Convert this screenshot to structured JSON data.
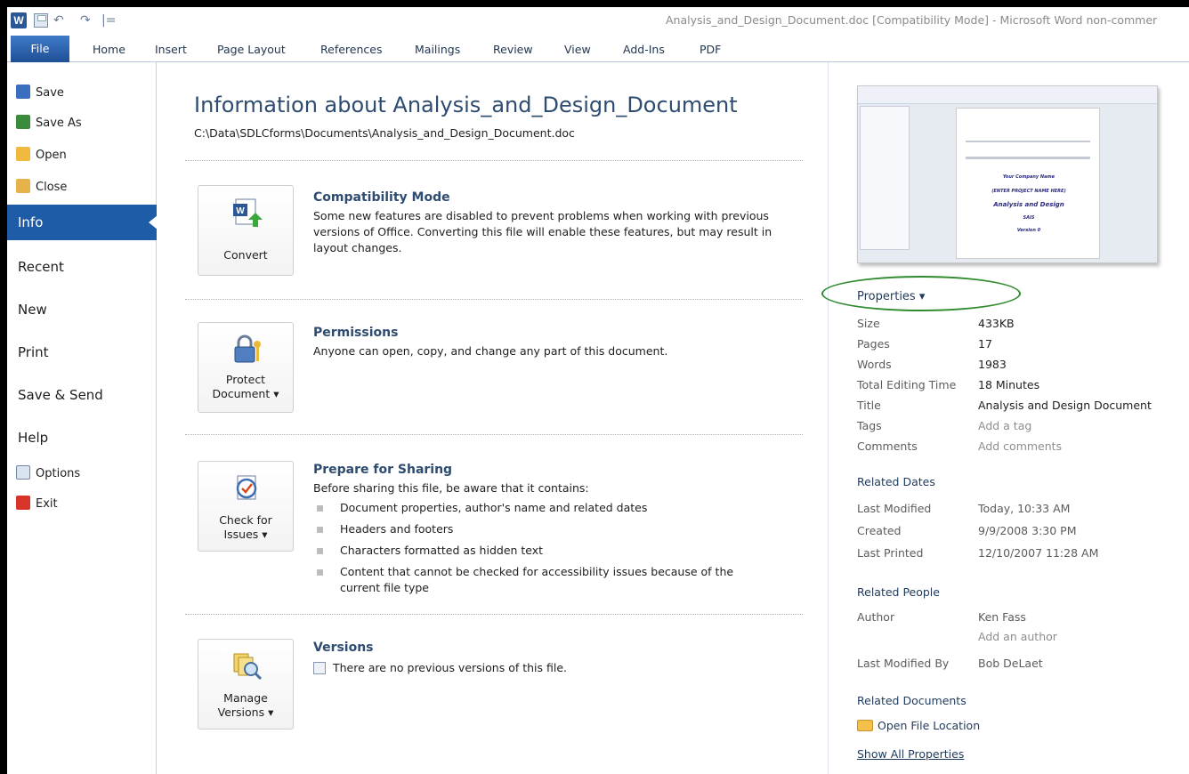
{
  "window": {
    "app_icon_label": "W",
    "title": "Analysis_and_Design_Document.doc [Compatibility Mode] - Microsoft Word non-commer",
    "qat_undo": "↶",
    "qat_redo": "↷",
    "qat_custom": "|="
  },
  "tabs": [
    {
      "label": "File"
    },
    {
      "label": "Home"
    },
    {
      "label": "Insert"
    },
    {
      "label": "Page Layout"
    },
    {
      "label": "References"
    },
    {
      "label": "Mailings"
    },
    {
      "label": "Review"
    },
    {
      "label": "View"
    },
    {
      "label": "Add-Ins"
    },
    {
      "label": "PDF"
    }
  ],
  "nav": {
    "commands": [
      {
        "label": "Save",
        "icon": "save-icon"
      },
      {
        "label": "Save As",
        "icon": "save-as-icon"
      },
      {
        "label": "Open",
        "icon": "open-folder-icon"
      },
      {
        "label": "Close",
        "icon": "close-folder-icon"
      }
    ],
    "items": [
      {
        "label": "Info"
      },
      {
        "label": "Recent"
      },
      {
        "label": "New"
      },
      {
        "label": "Print"
      },
      {
        "label": "Save & Send"
      },
      {
        "label": "Help"
      }
    ],
    "options_label": "Options",
    "exit_label": "Exit"
  },
  "main": {
    "title": "Information about Analysis_and_Design_Document",
    "path": "C:\\Data\\SDLCforms\\Documents\\Analysis_and_Design_Document.doc",
    "compat": {
      "button": "Convert",
      "title": "Compatibility Mode",
      "text": "Some new features are disabled to prevent problems when working with previous versions of Office. Converting this file will enable these features, but may result in layout changes."
    },
    "permissions": {
      "button_line1": "Protect",
      "button_line2": "Document ▾",
      "title": "Permissions",
      "text": "Anyone can open, copy, and change any part of this document."
    },
    "sharing": {
      "button_line1": "Check for",
      "button_line2": "Issues ▾",
      "title": "Prepare for Sharing",
      "intro": "Before sharing this file, be aware that it contains:",
      "bullets": [
        "Document properties, author's name and related dates",
        "Headers and footers",
        "Characters formatted as hidden text",
        "Content that cannot be checked for accessibility issues because of the current file type"
      ]
    },
    "versions": {
      "button_line1": "Manage",
      "button_line2": "Versions ▾",
      "title": "Versions",
      "text": "There are no previous versions of this file."
    }
  },
  "properties": {
    "header": "Properties ▾",
    "rows": [
      {
        "label": "Size",
        "value": "433KB"
      },
      {
        "label": "Pages",
        "value": "17"
      },
      {
        "label": "Words",
        "value": "1983"
      },
      {
        "label": "Total Editing Time",
        "value": "18 Minutes"
      },
      {
        "label": "Title",
        "value": "Analysis and Design Document"
      },
      {
        "label": "Tags",
        "value": "Add a tag"
      },
      {
        "label": "Comments",
        "value": "Add comments"
      }
    ],
    "related_dates": {
      "heading": "Related Dates",
      "rows": [
        {
          "label": "Last Modified",
          "value": "Today, 10:33 AM"
        },
        {
          "label": "Created",
          "value": "9/9/2008 3:30 PM"
        },
        {
          "label": "Last Printed",
          "value": "12/10/2007 11:28 AM"
        }
      ]
    },
    "related_people": {
      "heading": "Related People",
      "author_label": "Author",
      "author_value": "Ken Fass",
      "add_author": "Add an author",
      "modified_by_label": "Last Modified By",
      "modified_by_value": "Bob DeLaet"
    },
    "related_documents": {
      "heading": "Related Documents",
      "open_location": "Open File Location",
      "show_all": "Show All Properties"
    }
  },
  "thumbnail": {
    "line1": "Your Company Name",
    "line2": "(ENTER PROJECT NAME HERE)",
    "line3": "Analysis and Design",
    "line4": "SAIS",
    "line5": "Version 0"
  }
}
